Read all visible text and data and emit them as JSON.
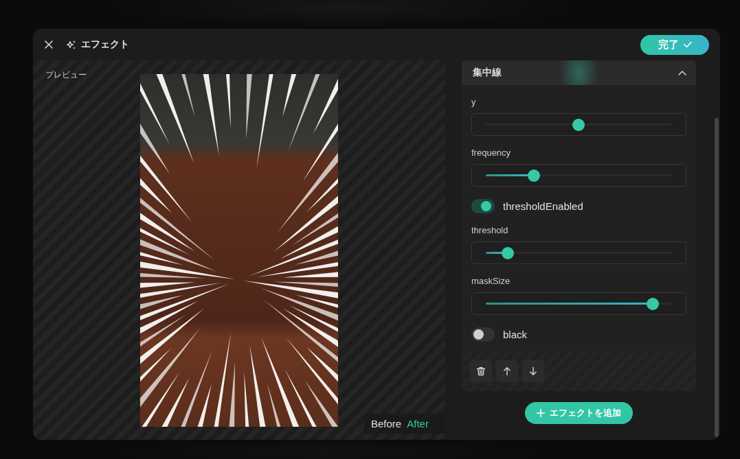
{
  "dialog": {
    "title": "エフェクト",
    "done_button": "完了"
  },
  "preview": {
    "label": "プレビュー",
    "compare": [
      {
        "label": "Before",
        "selected": false
      },
      {
        "label": "After",
        "selected": true
      }
    ]
  },
  "effects": [
    {
      "name": "集中線",
      "expanded": true,
      "params": [
        {
          "kind": "bipolar",
          "label": "y",
          "level": 0.5
        },
        {
          "kind": "slider",
          "label": "frequency",
          "level": 0.26
        },
        {
          "kind": "switch",
          "label": "thresholdEnabled",
          "on": true
        },
        {
          "kind": "slider",
          "label": "threshold",
          "level": 0.12
        },
        {
          "kind": "slider",
          "label": "maskSize",
          "level": 0.9
        },
        {
          "kind": "switch",
          "label": "black",
          "on": false
        }
      ]
    }
  ],
  "add_button": "エフェクトを追加"
}
